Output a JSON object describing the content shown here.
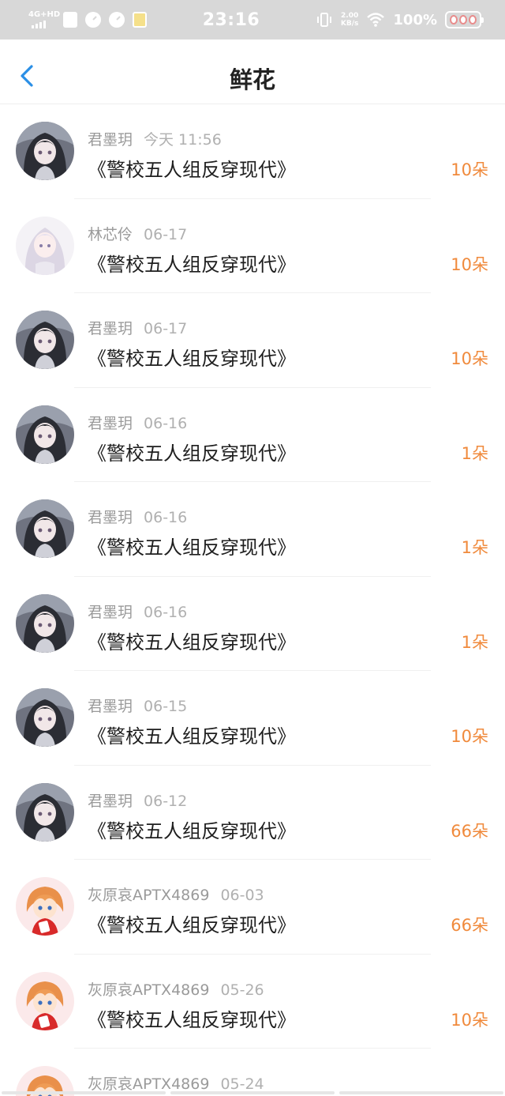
{
  "status_bar": {
    "network": "4G+HD",
    "time": "23:16",
    "net_speed_value": "2.00",
    "net_speed_unit": "KB/s",
    "battery": "100%"
  },
  "header": {
    "title": "鲜花",
    "back_icon": "chevron-left-icon"
  },
  "colors": {
    "accent": "#2b8fe6",
    "amount": "#f08a3c"
  },
  "records": [
    {
      "user": "君墨玥",
      "time": "今天 11:56",
      "book": "《警校五人组反穿现代》",
      "amount": "10朵",
      "avatar": "dark-hair-girl"
    },
    {
      "user": "林芯伶",
      "time": "06-17",
      "book": "《警校五人组反穿现代》",
      "amount": "10朵",
      "avatar": "silver-hair-girl"
    },
    {
      "user": "君墨玥",
      "time": "06-17",
      "book": "《警校五人组反穿现代》",
      "amount": "10朵",
      "avatar": "dark-hair-girl"
    },
    {
      "user": "君墨玥",
      "time": "06-16",
      "book": "《警校五人组反穿现代》",
      "amount": "1朵",
      "avatar": "dark-hair-girl"
    },
    {
      "user": "君墨玥",
      "time": "06-16",
      "book": "《警校五人组反穿现代》",
      "amount": "1朵",
      "avatar": "dark-hair-girl"
    },
    {
      "user": "君墨玥",
      "time": "06-16",
      "book": "《警校五人组反穿现代》",
      "amount": "1朵",
      "avatar": "dark-hair-girl"
    },
    {
      "user": "君墨玥",
      "time": "06-15",
      "book": "《警校五人组反穿现代》",
      "amount": "10朵",
      "avatar": "dark-hair-girl"
    },
    {
      "user": "君墨玥",
      "time": "06-12",
      "book": "《警校五人组反穿现代》",
      "amount": "66朵",
      "avatar": "dark-hair-girl"
    },
    {
      "user": "灰原哀APTX4869",
      "time": "06-03",
      "book": "《警校五人组反穿现代》",
      "amount": "66朵",
      "avatar": "orange-hair-girl"
    },
    {
      "user": "灰原哀APTX4869",
      "time": "05-26",
      "book": "《警校五人组反穿现代》",
      "amount": "10朵",
      "avatar": "orange-hair-girl"
    },
    {
      "user": "灰原哀APTX4869",
      "time": "05-24",
      "book": "",
      "amount": "",
      "avatar": "orange-hair-girl"
    }
  ]
}
